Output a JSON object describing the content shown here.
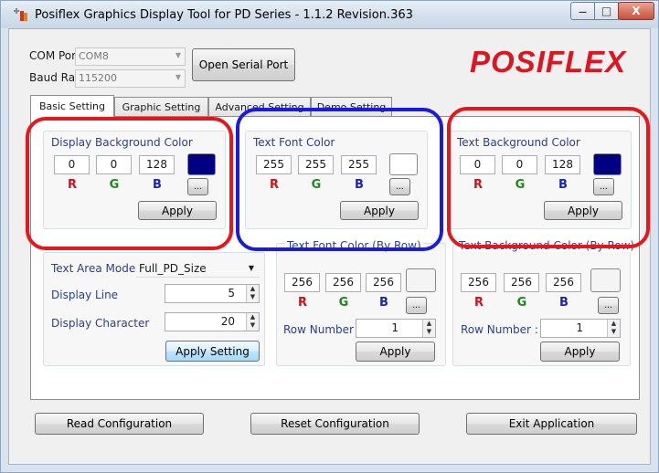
{
  "window": {
    "title": "Posiflex Graphics Display Tool for PD Series - 1.1.2 Revision.363",
    "minimize_glyph": "—",
    "maximize_glyph": "□",
    "close_glyph": "X"
  },
  "connection": {
    "com_port_label": "COM Port:",
    "com_port_value": "COM8",
    "baud_rate_label": "Baud Rate:",
    "baud_rate_value": "115200",
    "open_button": "Open Serial Port"
  },
  "brand": {
    "logo_text": "POSIFLEX",
    "logo_color": "#e0141e"
  },
  "tabs": [
    {
      "label": "Basic Setting",
      "active": true
    },
    {
      "label": "Graphic Setting",
      "active": false
    },
    {
      "label": "Advanced Setting",
      "active": false
    },
    {
      "label": "Demo Setting",
      "active": false
    }
  ],
  "rgb_labels": {
    "r": "R",
    "g": "G",
    "b": "B"
  },
  "groups": {
    "display_bg": {
      "title": "Display Background Color",
      "r": "0",
      "g": "0",
      "b": "128",
      "swatch": "#000080",
      "more": "...",
      "apply": "Apply"
    },
    "text_font": {
      "title": "Text Font Color",
      "r": "255",
      "g": "255",
      "b": "255",
      "swatch": "#ffffff",
      "more": "...",
      "apply": "Apply"
    },
    "text_bg": {
      "title": "Text Background Color",
      "r": "0",
      "g": "0",
      "b": "128",
      "swatch": "#000080",
      "more": "...",
      "apply": "Apply"
    },
    "font_by_row": {
      "title": "Text Font Color (By Row)",
      "r": "256",
      "g": "256",
      "b": "256",
      "swatch": "#f4f4f4",
      "more": "...",
      "row_label": "Row Number :",
      "row_value": "1",
      "apply": "Apply"
    },
    "bg_by_row": {
      "title": "Text Background Color (By Row)",
      "r": "256",
      "g": "256",
      "b": "256",
      "swatch": "#f4f4f4",
      "more": "...",
      "row_label": "Row Number :",
      "row_value": "1",
      "apply": "Apply"
    }
  },
  "text_area": {
    "mode_label": "Text Area Mode",
    "mode_value": "Full_PD_Size",
    "line_label": "Display Line",
    "line_value": "5",
    "char_label": "Display Character",
    "char_value": "20",
    "apply": "Apply Setting"
  },
  "footer": {
    "read": "Read Configuration",
    "reset": "Reset Configuration",
    "exit": "Exit Application"
  },
  "colors": {
    "red_ring": "#e8151b",
    "blue_ring": "#1b1bde",
    "r": "#d4101a",
    "g": "#1a8a1a",
    "b": "#1c24b8"
  }
}
